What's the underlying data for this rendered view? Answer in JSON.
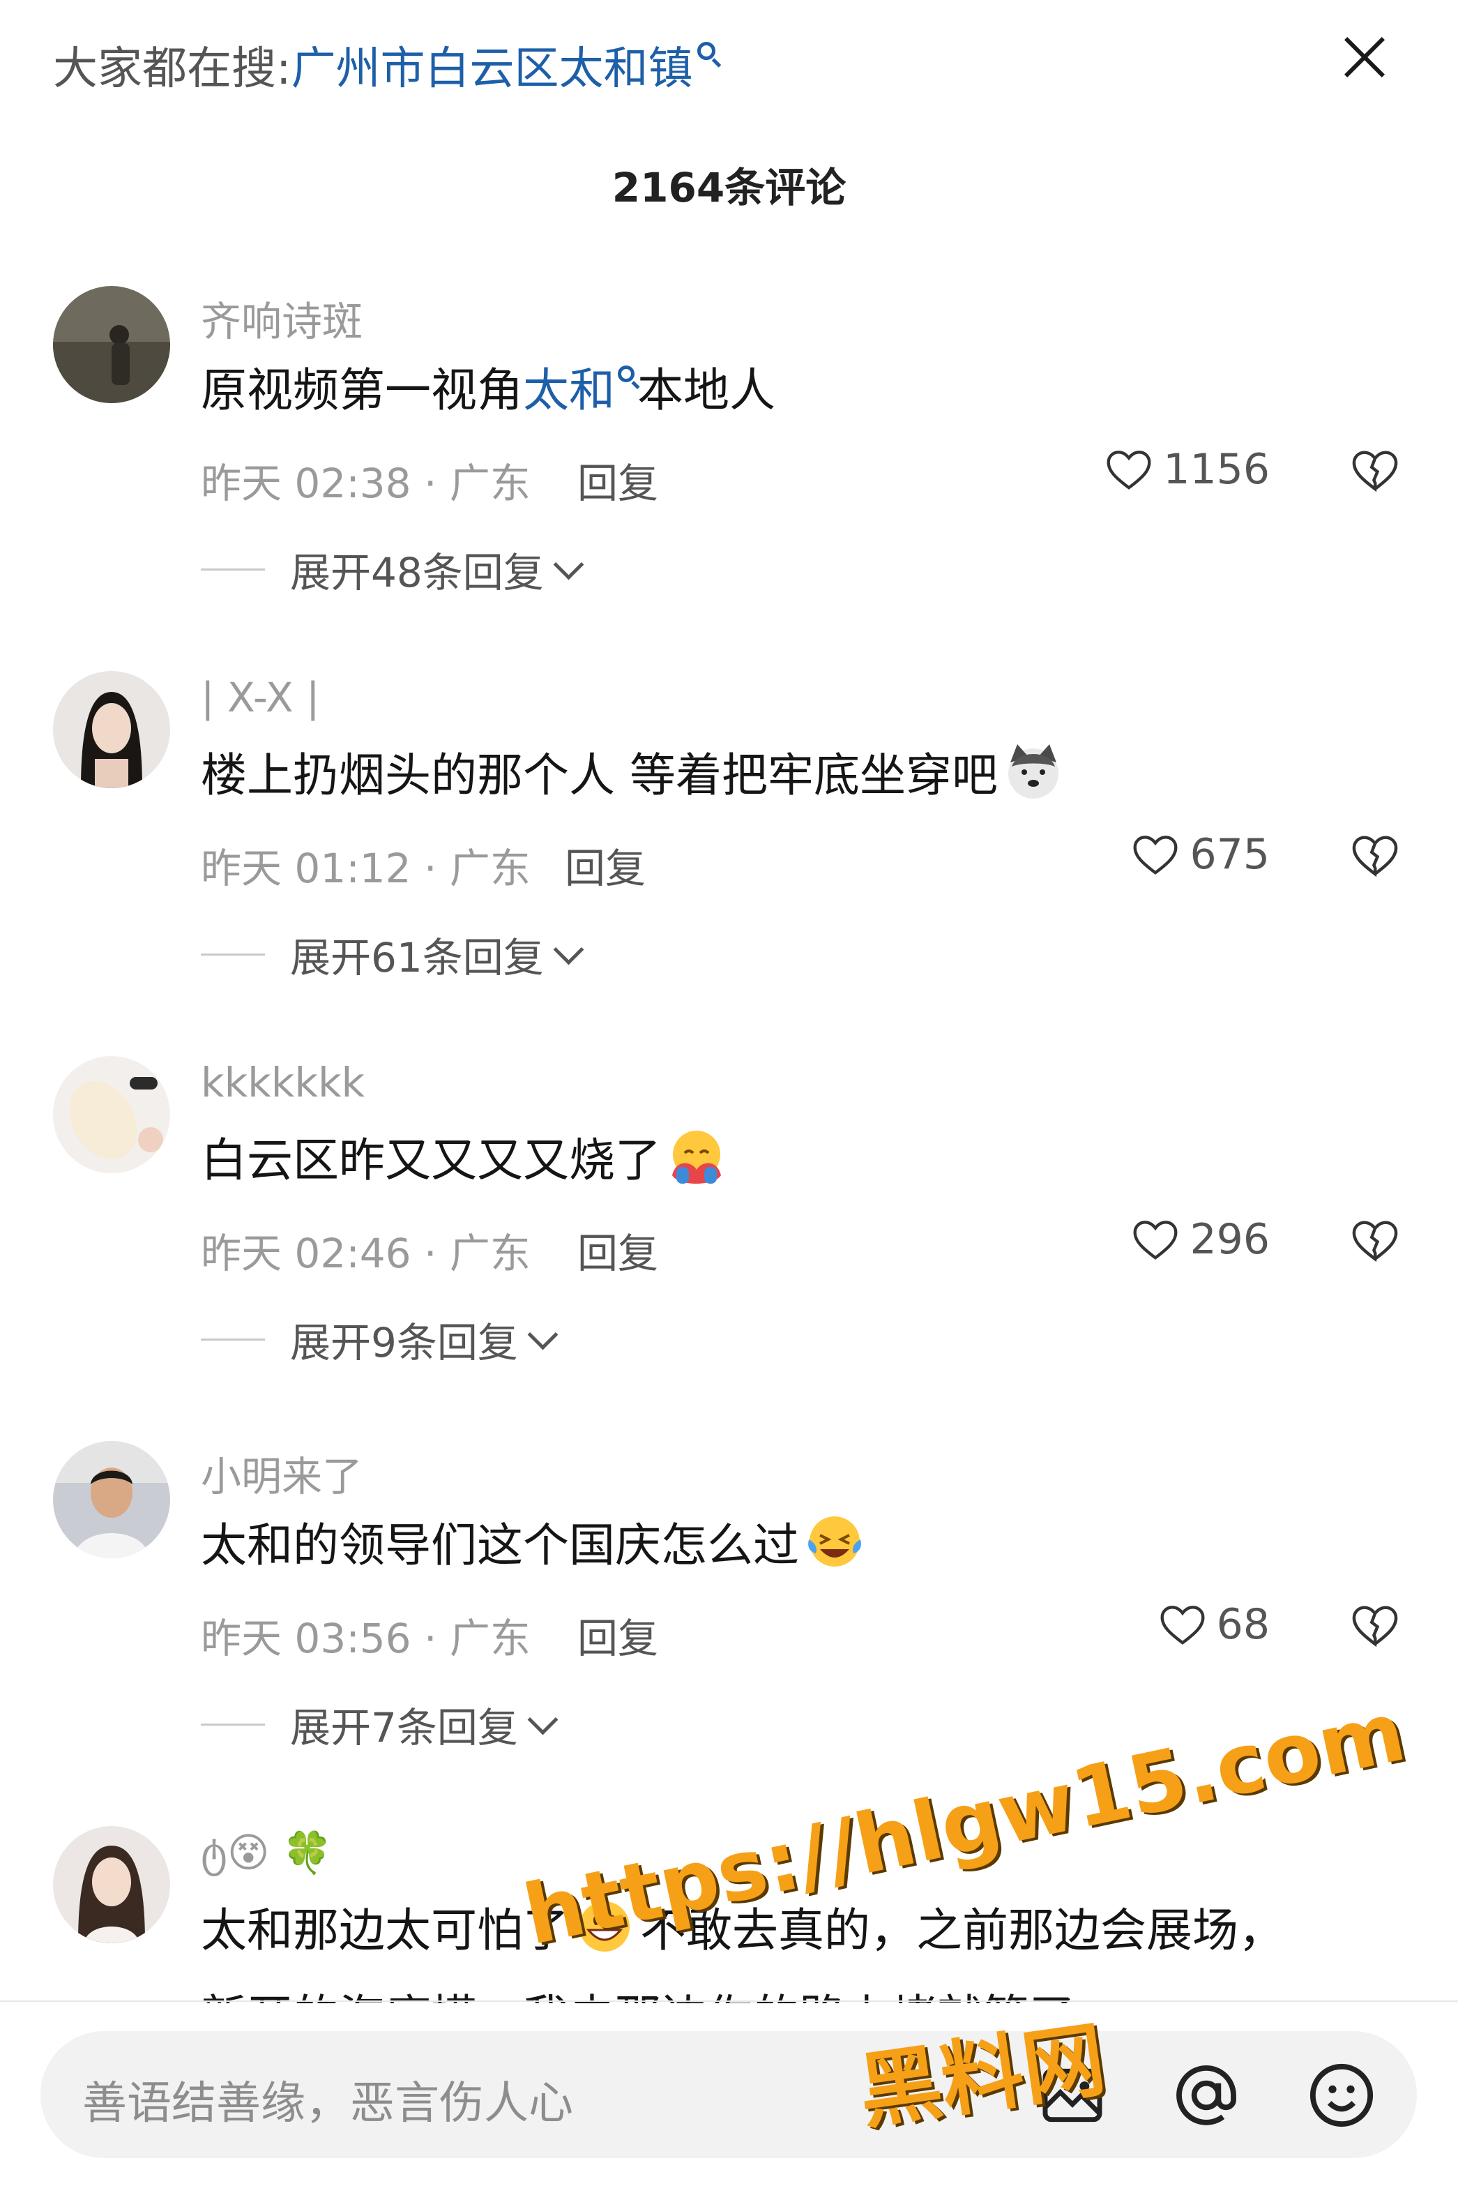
{
  "header": {
    "search_prefix": "大家都在搜:",
    "search_term": "广州市白云区太和镇",
    "comment_count": "2164条评论"
  },
  "comments": [
    {
      "username": "齐响诗斑",
      "text_before": "原视频第一视角",
      "text_link": "太和",
      "text_after": "本地人",
      "time_location": "昨天 02:38 · 广东",
      "reply_label": "回复",
      "likes": "1156",
      "expand": "展开48条回复"
    },
    {
      "username": "| X-X |",
      "text": "楼上扔烟头的那个人 等着把牢底坐穿吧",
      "emoji": "dog-face-emoji",
      "time_location": "昨天 01:12 · 广东",
      "reply_label": "回复",
      "likes": "675",
      "expand": "展开61条回复"
    },
    {
      "username": "kkkkkkk",
      "text": "白云区昨又又又又烧了",
      "emoji": "hugging-emoji",
      "time_location": "昨天 02:46 · 广东",
      "reply_label": "回复",
      "likes": "296",
      "expand": "展开9条回复"
    },
    {
      "username": "小明来了",
      "text": "太和的领导们这个国庆怎么过",
      "emoji": "crying-laughing-emoji",
      "time_location": "昨天 03:56 · 广东",
      "reply_label": "回复",
      "likes": "68",
      "expand": "展开7条回复"
    },
    {
      "username": "ტ😵 🍀",
      "text_before": "太和那边太可怕了",
      "emoji": "grinning-emoji",
      "text_after": "不敢去真的，之前那边会展场，",
      "partial_line": "新开的海底捞，我去那边你的路上堵就管了"
    }
  ],
  "input": {
    "placeholder": "善语结善缘，恶言伤人心"
  },
  "icons": [
    "close-icon",
    "search-icon",
    "heart-icon",
    "broken-heart-icon",
    "chevron-down-icon",
    "image-icon",
    "at-icon",
    "emoji-icon"
  ],
  "watermark": {
    "line1": "https://hlgw15.com",
    "line2": "黑料网"
  },
  "colors": {
    "link": "#1d5fa8",
    "muted": "#9a9a9a",
    "watermark": "#f6a018"
  }
}
